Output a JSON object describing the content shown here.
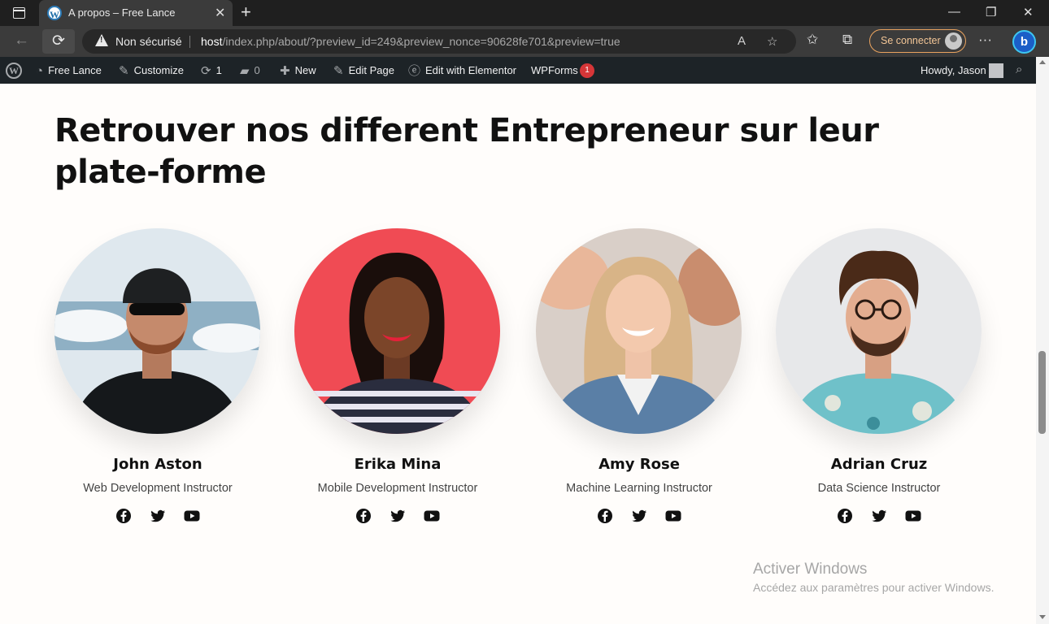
{
  "browser": {
    "tab_title": "A propos – Free Lance",
    "tab_close": "✕",
    "new_tab": "+",
    "window": {
      "minimize": "—",
      "maximize": "❐",
      "close": "✕"
    },
    "back": "←",
    "reload": "⟳",
    "security_label": "Non sécurisé",
    "url_host": "host",
    "url_path": "/index.php/about/?preview_id=249&preview_nonce=90628fe701&preview=true",
    "read_aloud": "A",
    "add_favorite": "☆",
    "favorites": "✩",
    "collections": "⧉",
    "more": "···",
    "signin_label": "Se connecter",
    "bing": "b"
  },
  "wp_admin_bar": {
    "wp_logo": "W",
    "site_name": "Free Lance",
    "customize": "Customize",
    "updates_count": "1",
    "comments_count": "0",
    "new": "New",
    "edit_page": "Edit Page",
    "edit_elementor": "Edit with Elementor",
    "wpforms": "WPForms",
    "wpforms_badge": "1",
    "howdy": "Howdy, Jason"
  },
  "main": {
    "headline": "Retrouver nos different Entrepreneur sur leur plate-forme",
    "team": [
      {
        "name": "John Aston",
        "role": "Web Development Instructor"
      },
      {
        "name": "Erika Mina",
        "role": "Mobile Development Instructor"
      },
      {
        "name": "Amy Rose",
        "role": "Machine Learning Instructor"
      },
      {
        "name": "Adrian Cruz",
        "role": "Data Science Instructor"
      }
    ],
    "social_icons": [
      "facebook-icon",
      "twitter-icon",
      "youtube-icon"
    ]
  },
  "watermark": {
    "title": "Activer Windows",
    "subtitle": "Accédez aux paramètres pour activer Windows."
  },
  "colors": {
    "page_bg": "#fffdfb",
    "wp_bar": "#1d2327",
    "badge": "#d63638",
    "signin_accent": "#e9a35f"
  }
}
